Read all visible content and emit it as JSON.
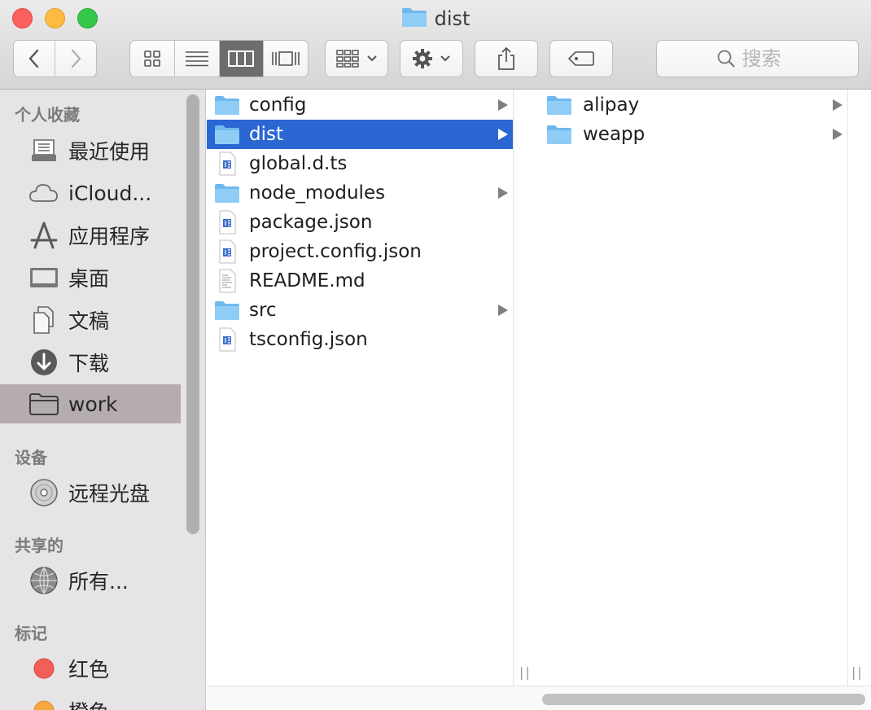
{
  "window": {
    "title": "dist",
    "title_icon": "folder-icon"
  },
  "toolbar": {
    "back": "chevron-left-icon",
    "forward": "chevron-right-icon",
    "view_modes": [
      "icon-view-icon",
      "list-view-icon",
      "column-view-icon",
      "cover-flow-icon"
    ],
    "active_view": "column-view-icon",
    "arrange": "arrange-grid-icon",
    "action": "gear-icon",
    "share": "share-icon",
    "tag": "tag-icon",
    "search_placeholder": "搜索"
  },
  "sidebar": {
    "favorites_header": "个人收藏",
    "favorites": [
      {
        "label": "最近使用",
        "icon": "recents-icon"
      },
      {
        "label": "iCloud...",
        "icon": "cloud-icon"
      },
      {
        "label": "应用程序",
        "icon": "applications-icon"
      },
      {
        "label": "桌面",
        "icon": "desktop-icon"
      },
      {
        "label": "文稿",
        "icon": "documents-icon"
      },
      {
        "label": "下载",
        "icon": "download-icon"
      },
      {
        "label": "work",
        "icon": "folder-icon",
        "selected": true
      }
    ],
    "devices_header": "设备",
    "devices": [
      {
        "label": "远程光盘",
        "icon": "disc-icon"
      }
    ],
    "shared_header": "共享的",
    "shared": [
      {
        "label": "所有...",
        "icon": "network-icon"
      }
    ],
    "tags_header": "标记",
    "tags": [
      {
        "label": "红色",
        "color": "#f25f58"
      },
      {
        "label": "橙色",
        "color": "#f6a940"
      }
    ]
  },
  "column1": {
    "items": [
      {
        "name": "config",
        "type": "folder",
        "has_children": true
      },
      {
        "name": "dist",
        "type": "folder",
        "has_children": true,
        "selected": true
      },
      {
        "name": "global.d.ts",
        "type": "code"
      },
      {
        "name": "node_modules",
        "type": "folder",
        "has_children": true
      },
      {
        "name": "package.json",
        "type": "code"
      },
      {
        "name": "project.config.json",
        "type": "code"
      },
      {
        "name": "README.md",
        "type": "text"
      },
      {
        "name": "src",
        "type": "folder",
        "has_children": true
      },
      {
        "name": "tsconfig.json",
        "type": "code"
      }
    ]
  },
  "column2": {
    "items": [
      {
        "name": "alipay",
        "type": "folder",
        "has_children": true
      },
      {
        "name": "weapp",
        "type": "folder",
        "has_children": true
      }
    ]
  },
  "colors": {
    "selection": "#2b67d2",
    "sidebar_selection": "#b4acae",
    "folder": "#7ec3f2"
  }
}
